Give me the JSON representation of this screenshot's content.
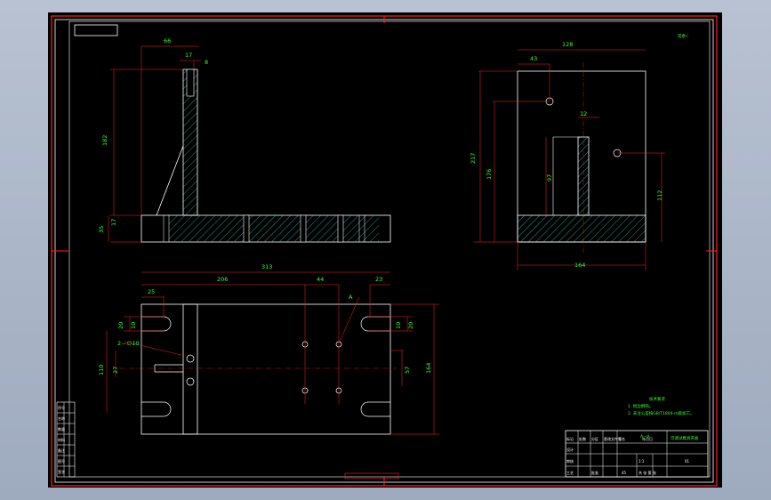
{
  "drawing": {
    "roughness_mark": "其余√",
    "section_label": "A—A",
    "tech_notes": [
      "技术要求",
      "1. 锐边倒钝。",
      "2. 未注公差按GB/T1804-m级加工。"
    ],
    "hole_callout": "2—∅10",
    "section_callout": "A"
  },
  "dimensions": {
    "front_view": {
      "width_top": "66",
      "slot_width": "17",
      "slot_depth": "8",
      "height": "182",
      "base_top": "17",
      "base_height": "35"
    },
    "side_view": {
      "width": "128",
      "offset": "43",
      "slot": "12",
      "total_height": "217",
      "height_176": "176",
      "height_97": "97",
      "height_112": "112",
      "base_width": "164"
    },
    "top_view": {
      "overall": "313",
      "span_206": "206",
      "span_44": "44",
      "end_23": "23",
      "left_25": "25",
      "y_20": "20",
      "y_10": "10",
      "y_right_10": "10",
      "y_right_20": "20",
      "y_27": "27",
      "y_110": "110",
      "y_57": "57",
      "y_164": "164"
    }
  },
  "title_block": {
    "title": "可调试模具夹板",
    "code": "01",
    "scale": "1:1",
    "material": "45",
    "rows": [
      "标记",
      "处数",
      "分区",
      "更改文件号",
      "签名",
      "年月日"
    ],
    "roles": [
      "设计",
      "审核",
      "工艺",
      "批准"
    ],
    "sheet": "共 张 第 张"
  },
  "left_strip": [
    "序号",
    "名称",
    "数量",
    "材料",
    "备注",
    "图号",
    "签字"
  ]
}
